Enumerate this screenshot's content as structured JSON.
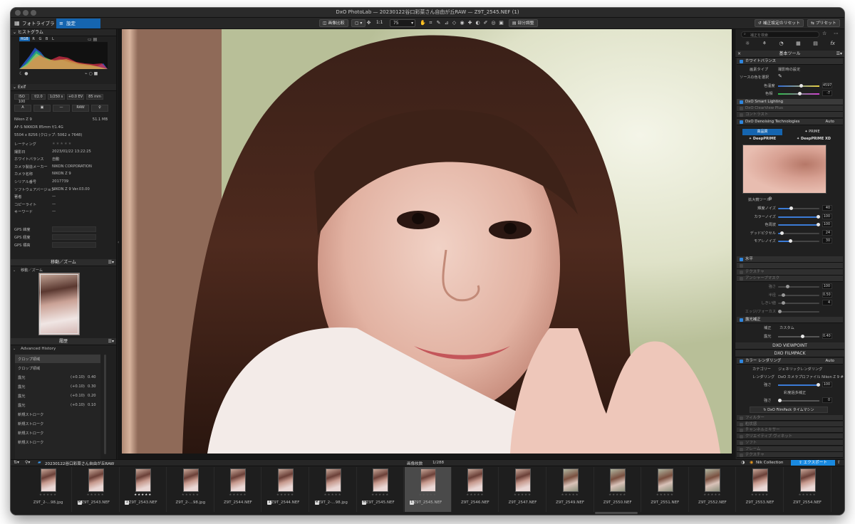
{
  "window": {
    "title": "DxO PhotoLab — 20230122谷口彩菜さん自由が丘RAW — Z9T_2545.NEF (1)"
  },
  "toolbar": {
    "tab_library": "フォトライブラリ",
    "tab_customize": "設定",
    "compare": "画像比較",
    "zoom": "1:1",
    "zoom_pct": "75",
    "local_adj": "部分調整",
    "reset": "補正設定のリセット",
    "preset": "プリセット"
  },
  "histogram": {
    "title": "ヒストグラム",
    "channels": [
      "RGB",
      "R",
      "G",
      "B",
      "L"
    ]
  },
  "exif": {
    "title": "Exif",
    "iso": "ISO 100",
    "aperture": "f/2.0",
    "shutter": "1/250 s",
    "ev": "+0.0 EV",
    "focal": "85 mm",
    "mode_a": "A",
    "mode_dash": "—",
    "raw": "RAW",
    "camera": "Nikon Z 9",
    "size": "51.1 MB",
    "lens": "AF-S NIKKOR 85mm f/1.4G",
    "res": "5504 x 8256 (クロップ: 5062 x 7648)"
  },
  "info": {
    "rows": [
      [
        "レーティング",
        "★★★★★"
      ],
      [
        "撮影日",
        "2023/01/22 13:22:25"
      ],
      [
        "ホワイトバランス",
        "自動"
      ],
      [
        "カメラ製造メーカー",
        "NIKON CORPORATION"
      ],
      [
        "カメラ名称",
        "NIKON Z 9"
      ],
      [
        "シリアル番号",
        "2017739"
      ],
      [
        "ソフトウェアバージョン",
        "NIKON Z 9 Ver.03.00"
      ],
      [
        "著者",
        "—"
      ],
      [
        "コピーライト",
        "—"
      ],
      [
        "キーワード",
        "—"
      ]
    ],
    "gps": [
      "GPS 緯度",
      "GPS 経度",
      "GPS 標高"
    ]
  },
  "move": {
    "header": "移動／ズーム",
    "label": "移動／ズーム"
  },
  "history": {
    "header": "履歴",
    "title": "Advanced History",
    "items": [
      [
        "クロップ領域",
        ""
      ],
      [
        "クロップ領域",
        ""
      ],
      [
        "露光",
        "(+0.10)",
        "0.40"
      ],
      [
        "露光",
        "(+0.10)",
        "0.30"
      ],
      [
        "露光",
        "(+0.10)",
        "0.20"
      ],
      [
        "露光",
        "(+0.10)",
        "0.10"
      ],
      [
        "新規ストローク",
        ""
      ],
      [
        "新規ストローク",
        ""
      ],
      [
        "新規ストローク",
        ""
      ],
      [
        "新規ストローク",
        ""
      ]
    ]
  },
  "right": {
    "search_placeholder": "補正を検索",
    "basic": "基本ツール",
    "wb": "ホワイトバランス",
    "wb_type_label": "画素タイプ",
    "wb_type": "撮影時の設定",
    "pick": "ソースの色を選択",
    "temp_label": "色温度",
    "temp": "4597",
    "tint_label": "色相",
    "tint": "-7",
    "smart": "DxO Smart Lighting",
    "clear": "DxO ClearView Plus",
    "contrast": "コントラスト",
    "denoise": "DxO Denoising Technologies",
    "auto": "Auto",
    "hq": "高品質",
    "prime": "PRIME",
    "deepprime": "DeepPRIME",
    "deepprimexd": "DeepPRIME XD",
    "magnifier": "拡大鏡ツール",
    "dn": [
      [
        "輝度ノイズ",
        "40"
      ],
      [
        "カラーノイズ",
        "100"
      ],
      [
        "色周波",
        "100"
      ],
      [
        "デッドピクセル",
        "24"
      ],
      [
        "モアレノイズ",
        "30"
      ]
    ],
    "level": "水平",
    "sharp": "アンシャープマスク",
    "sharp_vals": [
      [
        "強さ",
        "100"
      ],
      [
        "半径",
        "0.50"
      ],
      [
        "しきい値",
        "4"
      ],
      [
        "エッジ/フォーカス",
        ""
      ]
    ],
    "exposure": "露光補正",
    "exp_mode_label": "補正",
    "exp_mode": "カスタム",
    "exp_label": "露光",
    "exp": "0.40",
    "viewpoint": "DXO VIEWPOINT",
    "filmpack": "DXO FILMPACK",
    "color_render": "カラー レンダリング",
    "cat_label": "カテゴリー",
    "cat": "ジェネリックレンダリング",
    "render_label": "レンダリング",
    "render": "DxO カメラプロファイル Nikon Z 9 #",
    "strength_label": "強さ",
    "strength": "100",
    "gamut": "彩度過多補正",
    "gamut_label": "強さ",
    "gamut_v": "0",
    "timemachine": "DxO FilmPack タイムマシン",
    "extra": [
      "フィルター",
      "粒状感",
      "チャンネルミキサー",
      "クリエイティブ ヴィネット",
      "ソフト",
      "フレーム",
      "テクスチャ"
    ]
  },
  "filmbar": {
    "folder": "20230122谷口彩菜さん自由が丘RAW",
    "count_label": "画像枚数",
    "count": "1/288",
    "nik": "Nik Collection",
    "export": "エクスポート"
  },
  "thumbs": [
    [
      "Z9T_2-…98.jpg",
      "",
      ""
    ],
    [
      "Z9T_2543.NEF",
      "M",
      ""
    ],
    [
      "Z9T_2543.NEF",
      "1",
      "★★"
    ],
    [
      "Z9T_2-…98.jpg",
      "",
      ""
    ],
    [
      "Z9T_2544.NEF",
      "",
      ""
    ],
    [
      "Z9T_2544.NEF",
      "1",
      ""
    ],
    [
      "Z9T_2-…98.jpg",
      "M",
      ""
    ],
    [
      "Z9T_2545.NEF",
      "M",
      ""
    ],
    [
      "Z9T_2545.NEF",
      "1",
      ""
    ],
    [
      "Z9T_2546.NEF",
      "",
      ""
    ],
    [
      "Z9T_2547.NEF",
      "",
      ""
    ],
    [
      "Z9T_2549.NEF",
      "",
      ""
    ],
    [
      "Z9T_2550.NEF",
      "",
      ""
    ],
    [
      "Z9T_2551.NEF",
      "",
      ""
    ],
    [
      "Z9T_2552.NEF",
      "",
      ""
    ],
    [
      "Z9T_2553.NEF",
      "",
      ""
    ],
    [
      "Z9T_2554.NEF",
      "",
      ""
    ]
  ]
}
